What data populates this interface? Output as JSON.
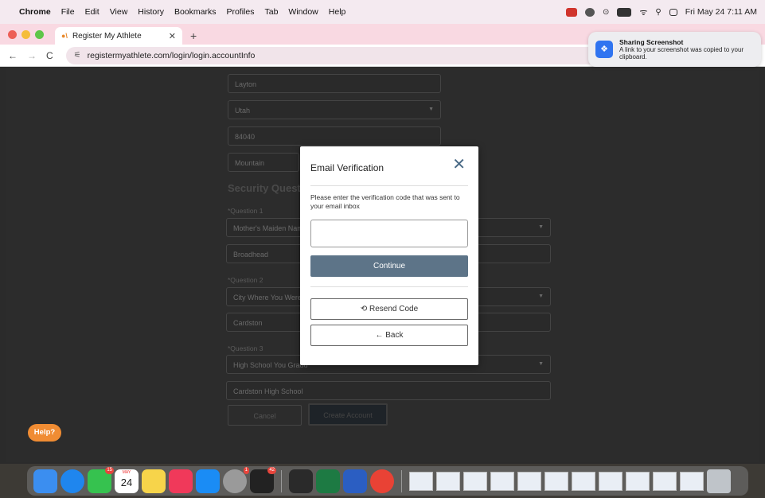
{
  "menubar": {
    "app_name": "Chrome",
    "items": [
      "File",
      "Edit",
      "View",
      "History",
      "Bookmarks",
      "Profiles",
      "Tab",
      "Window",
      "Help"
    ],
    "clock": "Fri May 24  7:11 AM"
  },
  "browser": {
    "tab_title": "Register My Athlete",
    "url": "registermyathlete.com/login/login.accountInfo"
  },
  "form": {
    "city": "Layton",
    "state": "Utah",
    "zip": "84040",
    "timezone": "Mountain",
    "security_title": "Security Question",
    "q1_label": "*Question 1",
    "q1_select": "Mother's Maiden Name",
    "q1_answer": "Broadhead",
    "q2_label": "*Question 2",
    "q2_select": "City Where You Were Bo",
    "q2_answer": "Cardston",
    "q3_label": "*Question 3",
    "q3_select": "High School You Gradu",
    "q3_answer": "Cardston High School",
    "cancel_label": "Cancel",
    "create_label": "Create Account"
  },
  "help_label": "Help?",
  "modal": {
    "title": "Email Verification",
    "description": "Please enter the verification code that was sent to your email inbox",
    "code_value": "",
    "continue_label": "Continue",
    "resend_label": "Resend Code",
    "back_label": "Back"
  },
  "notification": {
    "title": "Sharing Screenshot",
    "body": "A link to your screenshot was copied to your clipboard."
  },
  "dock": {
    "calendar_month": "MAY",
    "calendar_day": "24",
    "messages_badge": "15",
    "settings_badge": "1",
    "app_badge": "42"
  },
  "colors": {
    "continue_bg": "#5d7488",
    "help_bg": "#f08c33",
    "tabstrip_bg": "#f9d9e2"
  }
}
